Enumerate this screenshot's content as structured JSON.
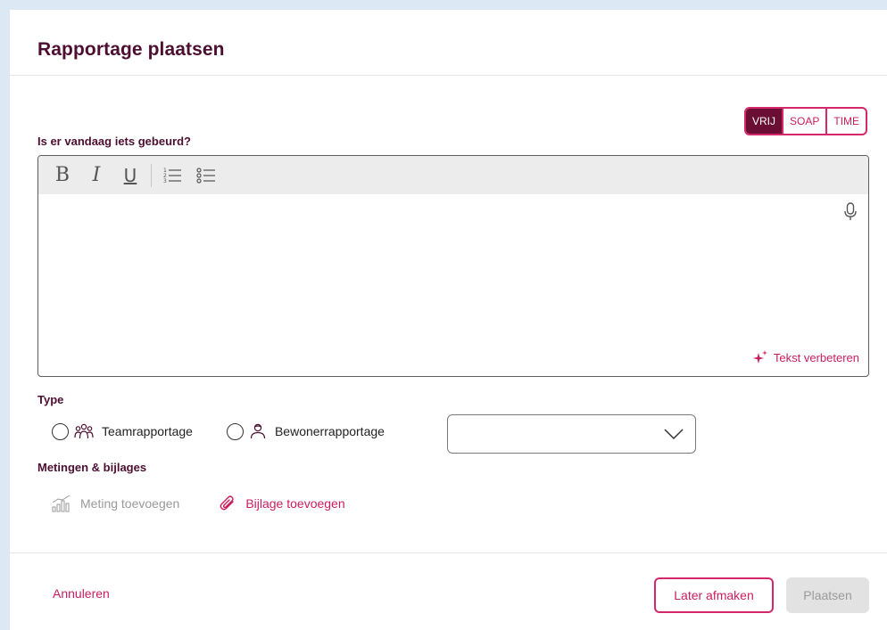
{
  "dialog": {
    "title": "Rapportage plaatsen"
  },
  "mode_toggle": {
    "options": [
      "VRIJ",
      "SOAP",
      "TIME"
    ],
    "selected": "VRIJ"
  },
  "editor": {
    "question": "Is er vandaag iets gebeurd?",
    "toolbar": {
      "bold": "B",
      "italic": "I",
      "underline": "U",
      "ordered_list": "ordered-list-icon",
      "bullet_list": "bullet-list-icon"
    },
    "content": "",
    "improve_label": "Tekst verbeteren",
    "mic_icon": "microphone-icon"
  },
  "type": {
    "label": "Type",
    "options": [
      {
        "label": "Teamrapportage",
        "icon": "team-icon",
        "checked": false
      },
      {
        "label": "Bewonerrapportage",
        "icon": "resident-icon",
        "checked": false
      }
    ],
    "select_value": ""
  },
  "attachments": {
    "label": "Metingen & bijlages",
    "add_measurement": "Meting toevoegen",
    "add_attachment": "Bijlage toevoegen"
  },
  "footer": {
    "cancel": "Annuleren",
    "later": "Later afmaken",
    "place": "Plaatsen"
  },
  "colors": {
    "brand_dark": "#4d0f31",
    "accent": "#c91e5d",
    "active_segment": "#6a0f33",
    "background": "#dce8f3"
  }
}
